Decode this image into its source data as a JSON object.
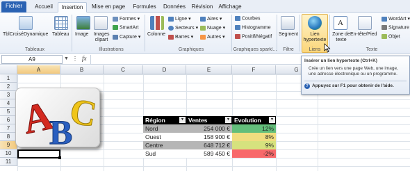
{
  "tabs": [
    "Fichier",
    "Accueil",
    "Insertion",
    "Mise en page",
    "Formules",
    "Données",
    "Révision",
    "Affichage"
  ],
  "ribbon": {
    "tableaux": {
      "pivot": "TblCroiséDynamique",
      "table": "Tableau",
      "label": "Tableaux"
    },
    "illustrations": {
      "image": "Image",
      "clipart": "Images clipart",
      "formes": "Formes",
      "smartart": "SmartArt",
      "capture": "Capture",
      "label": "Illustrations"
    },
    "graphiques": {
      "colonne": "Colonne",
      "ligne": "Ligne",
      "secteurs": "Secteurs",
      "barres": "Barres",
      "aires": "Aires",
      "nuage": "Nuage",
      "autres": "Autres",
      "label": "Graphiques"
    },
    "sparklines": {
      "courbes": "Courbes",
      "histogramme": "Histogramme",
      "positif": "Positif/Négatif",
      "label": "Graphiques sparkl..."
    },
    "filtre": {
      "segment": "Segment",
      "label": "Filtre"
    },
    "liens": {
      "lien": "Lien hypertexte",
      "label": "Liens"
    },
    "texte": {
      "zone": "Zone de texte",
      "entete": "En-tête/Pied",
      "wordart": "WordArt",
      "signature": "Signature",
      "objet": "Objet",
      "label": "Texte"
    }
  },
  "namebox": "A9",
  "fx": "fx",
  "columns": [
    "A",
    "B",
    "C",
    "D",
    "E",
    "F",
    "G"
  ],
  "rows": [
    "1",
    "2",
    "3",
    "4",
    "5",
    "6",
    "7",
    "8",
    "9",
    "10",
    "11"
  ],
  "table": {
    "headers": [
      "Région",
      "Ventes",
      "Evolution"
    ],
    "rows": [
      {
        "region": "Nord",
        "ventes": "254 000 €",
        "evolution": "12%",
        "color": "#63be7b"
      },
      {
        "region": "Ouest",
        "ventes": "158 900 €",
        "evolution": "8%",
        "color": "#f0dd7f"
      },
      {
        "region": "Centre",
        "ventes": "648 712 €",
        "evolution": "9%",
        "color": "#d6e27e"
      },
      {
        "region": "Sud",
        "ventes": "589 450 €",
        "evolution": "-2%",
        "color": "#f8696b"
      }
    ]
  },
  "tooltip": {
    "title": "Insérer un lien hypertexte (Ctrl+K)",
    "body": "Crée un lien vers une page Web, une image, une adresse électronique ou un programme.",
    "help": "Appuyez sur F1 pour obtenir de l'aide."
  },
  "logo": {
    "letters": "ABC"
  }
}
